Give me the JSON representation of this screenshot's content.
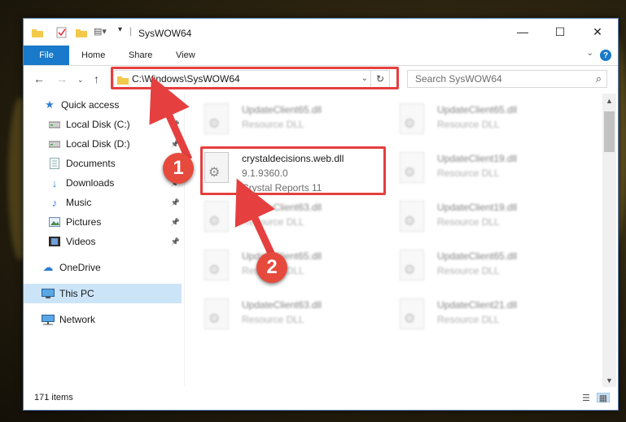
{
  "window": {
    "title": "SysWOW64",
    "controls": {
      "minimize": "—",
      "maximize": "☐",
      "close": "✕"
    }
  },
  "ribbon": {
    "tabs": [
      "File",
      "Home",
      "Share",
      "View"
    ],
    "help": "?"
  },
  "address_bar": {
    "path": "C:\\Windows\\SysWOW64",
    "search_placeholder": "Search SysWOW64"
  },
  "sidebar": {
    "items": [
      {
        "label": "Quick access",
        "icon": "star-icon",
        "pinned": false
      },
      {
        "label": "Local Disk (C:)",
        "icon": "drive-icon",
        "pinned": true
      },
      {
        "label": "Local Disk (D:)",
        "icon": "drive-icon",
        "pinned": true
      },
      {
        "label": "Documents",
        "icon": "documents-icon",
        "pinned": true
      },
      {
        "label": "Downloads",
        "icon": "downloads-icon",
        "pinned": true
      },
      {
        "label": "Music",
        "icon": "music-icon",
        "pinned": true
      },
      {
        "label": "Pictures",
        "icon": "pictures-icon",
        "pinned": true
      },
      {
        "label": "Videos",
        "icon": "videos-icon",
        "pinned": true
      },
      {
        "label": "OneDrive",
        "icon": "cloud-icon",
        "pinned": false
      },
      {
        "label": "This PC",
        "icon": "computer-icon",
        "pinned": false,
        "selected": true
      },
      {
        "label": "Network",
        "icon": "network-icon",
        "pinned": false
      }
    ]
  },
  "files": [
    {
      "name": "UpdateClient65.dll",
      "type": "Resource DLL"
    },
    {
      "name": "UpdateClient65.dll",
      "type": "Resource DLL"
    },
    {
      "name": "crystaldecisions.web.dll",
      "version": "9.1.9360.0",
      "product": "Crystal Reports 11",
      "highlighted": true
    },
    {
      "name": "UpdateClient19.dll",
      "type": "Resource DLL"
    },
    {
      "name": "UpdateClient63.dll",
      "type": "Resource DLL"
    },
    {
      "name": "UpdateClient19.dll",
      "type": "Resource DLL"
    },
    {
      "name": "UpdateClient65.dll",
      "type": "Resource DLL"
    },
    {
      "name": "UpdateClient65.dll",
      "type": "Resource DLL"
    },
    {
      "name": "UpdateClient63.dll",
      "type": "Resource DLL"
    },
    {
      "name": "UpdateClient21.dll",
      "type": "Resource DLL"
    }
  ],
  "status_bar": {
    "item_count": "171 items"
  },
  "annotations": {
    "step1": "1",
    "step2": "2",
    "color": "#e53f3f"
  }
}
